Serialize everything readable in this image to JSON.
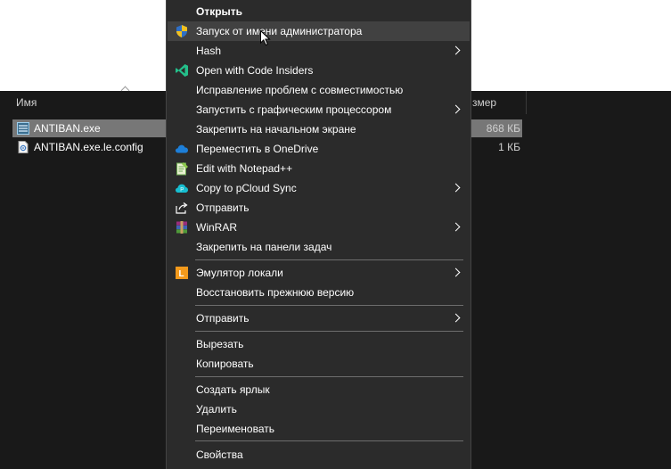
{
  "explorer": {
    "column_name": "Имя",
    "column_size": "змер",
    "files": [
      {
        "name": "ANTIBAN.exe",
        "size": "868 КБ",
        "selected": true,
        "icon": "app-icon"
      },
      {
        "name": "ANTIBAN.exe.le.config",
        "size": "1 КБ",
        "selected": false,
        "icon": "config-file-icon"
      }
    ]
  },
  "menu": {
    "items": [
      {
        "label": "Открыть",
        "icon": "",
        "submenu": false,
        "bold": true
      },
      {
        "label": "Запуск от имени администратора",
        "icon": "shield-icon",
        "submenu": false,
        "hover": true
      },
      {
        "label": "Hash",
        "icon": "",
        "submenu": true
      },
      {
        "label": "Open with Code Insiders",
        "icon": "vscode-insiders-icon",
        "submenu": false
      },
      {
        "label": "Исправление проблем с совместимостью",
        "icon": "",
        "submenu": false
      },
      {
        "label": "Запустить с графическим процессором",
        "icon": "",
        "submenu": true
      },
      {
        "label": "Закрепить на начальном экране",
        "icon": "",
        "submenu": false
      },
      {
        "label": "Переместить в OneDrive",
        "icon": "onedrive-icon",
        "submenu": false
      },
      {
        "label": "Edit with Notepad++",
        "icon": "notepadpp-icon",
        "submenu": false
      },
      {
        "label": "Copy to pCloud Sync",
        "icon": "pcloud-icon",
        "submenu": true
      },
      {
        "label": "Отправить",
        "icon": "share-icon",
        "submenu": false
      },
      {
        "label": "WinRAR",
        "icon": "winrar-icon",
        "submenu": true
      },
      {
        "label": "Закрепить на панели задач",
        "icon": "",
        "submenu": false
      },
      {
        "label": "Эмулятор локали",
        "icon": "locale-emulator-icon",
        "submenu": true
      },
      {
        "label": "Восстановить прежнюю версию",
        "icon": "",
        "submenu": false
      },
      {
        "label": "Отправить",
        "icon": "",
        "submenu": true
      },
      {
        "label": "Вырезать",
        "icon": "",
        "submenu": false
      },
      {
        "label": "Копировать",
        "icon": "",
        "submenu": false
      },
      {
        "label": "Создать ярлык",
        "icon": "",
        "submenu": false
      },
      {
        "label": "Удалить",
        "icon": "",
        "submenu": false
      },
      {
        "label": "Переименовать",
        "icon": "",
        "submenu": false
      },
      {
        "label": "Свойства",
        "icon": "",
        "submenu": false
      }
    ]
  },
  "colors": {
    "menu_bg": "#2b2b2b",
    "menu_hover": "#414141",
    "separator": "#6d6d6d",
    "explorer_bg": "#191919",
    "selected_row": "#777777"
  }
}
